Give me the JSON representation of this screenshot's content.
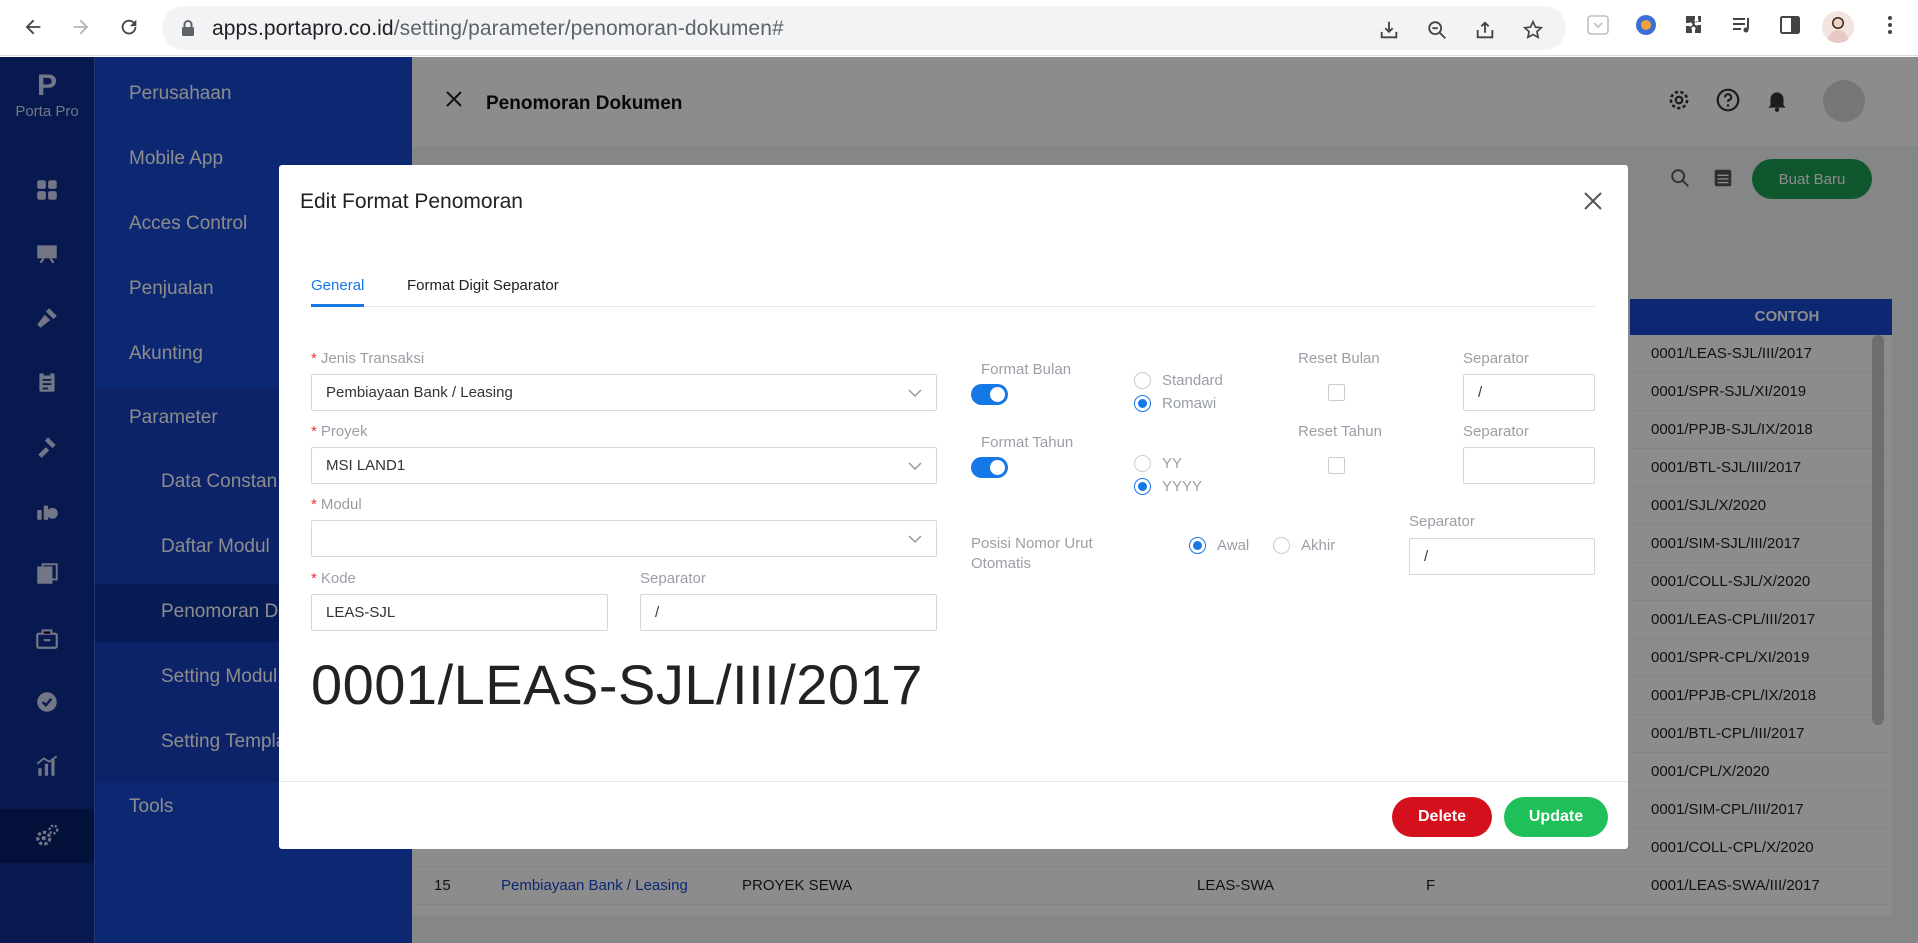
{
  "browser": {
    "url_host": "apps.portapro.co.id",
    "url_path": "/setting/parameter/penomoran-dokumen#"
  },
  "app": {
    "logo_name": "Porta Pro",
    "logo_letter": "P"
  },
  "menu": {
    "items": [
      "Perusahaan",
      "Mobile App",
      "Acces Control",
      "Penjualan",
      "Akunting",
      "Parameter"
    ],
    "sub_items": [
      "Data Constan",
      "Daftar Modul",
      "Penomoran Do",
      "Setting Modul",
      "Setting Templa"
    ],
    "tools": "Tools"
  },
  "page": {
    "title": "Penomoran Dokumen",
    "new_button": "Buat Baru",
    "column_contoh": "CONTOH",
    "contoh_rows": [
      "0001/LEAS-SJL/III/2017",
      "0001/SPR-SJL/XI/2019",
      "0001/PPJB-SJL/IX/2018",
      "0001/BTL-SJL/III/2017",
      "0001/SJL/X/2020",
      "0001/SIM-SJL/III/2017",
      "0001/COLL-SJL/X/2020",
      "0001/LEAS-CPL/III/2017",
      "0001/SPR-CPL/XI/2019",
      "0001/PPJB-CPL/IX/2018",
      "0001/BTL-CPL/III/2017",
      "0001/CPL/X/2020",
      "0001/SIM-CPL/III/2017",
      "0001/COLL-CPL/X/2020"
    ],
    "last_row": {
      "no": "15",
      "transaksi": "Pembiayaan Bank / Leasing",
      "proyek": "PROYEK SEWA",
      "kode": "LEAS-SWA",
      "f": "F",
      "contoh": "0001/LEAS-SWA/III/2017"
    }
  },
  "modal": {
    "title": "Edit Format Penomoran",
    "tabs": [
      "General",
      "Format Digit Separator"
    ],
    "jenis_transaksi_label": "Jenis Transaksi",
    "jenis_transaksi_value": "Pembiayaan Bank / Leasing",
    "proyek_label": "Proyek",
    "proyek_value": "MSI LAND1",
    "modul_label": "Modul",
    "modul_value": "",
    "kode_label": "Kode",
    "kode_value": "LEAS-SJL",
    "separator_label": "Separator",
    "kode_separator_value": "/",
    "format_bulan_label": "Format Bulan",
    "format_tahun_label": "Format Tahun",
    "bulan_options": [
      "Standard",
      "Romawi"
    ],
    "tahun_options": [
      "YY",
      "YYYY"
    ],
    "reset_bulan_label": "Reset Bulan",
    "reset_tahun_label": "Reset Tahun",
    "bulan_separator_value": "/",
    "tahun_separator_value": "",
    "posisi_label_1": "Posisi Nomor Urut",
    "posisi_label_2": "Otomatis",
    "posisi_options": [
      "Awal",
      "Akhir"
    ],
    "posisi_separator_value": "/",
    "preview": "0001/LEAS-SJL/III/2017",
    "delete_button": "Delete",
    "update_button": "Update"
  },
  "colors": {
    "rail": "#0d2e8f",
    "menu": "#1849cf",
    "accent": "#1677e6",
    "delete": "#d3101c",
    "update": "#1fbf5a"
  }
}
